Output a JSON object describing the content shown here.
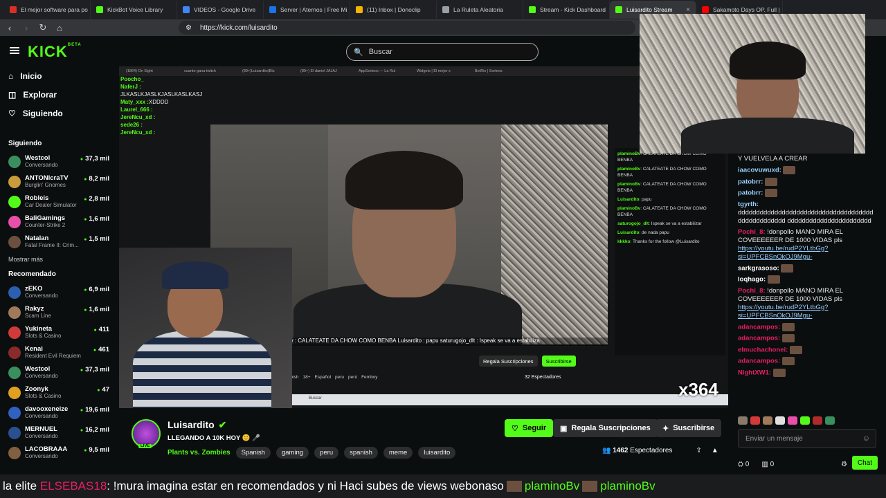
{
  "browser": {
    "tabs": [
      {
        "label": "El mejor software para po",
        "color": "#d93025"
      },
      {
        "label": "KickBot Voice Library",
        "color": "#53fc18"
      },
      {
        "label": "VIDEOS - Google Drive",
        "color": "#4285f4"
      },
      {
        "label": "Server | Aternos | Free Mi",
        "color": "#1a73e8"
      },
      {
        "label": "(11) Inbox | Donoclip",
        "color": "#f4b400"
      },
      {
        "label": "La Ruleta Aleatoria",
        "color": "#9aa0a6"
      },
      {
        "label": "Stream - Kick Dashboard",
        "color": "#53fc18"
      },
      {
        "label": "Luisardito Stream",
        "color": "#53fc18",
        "active": true
      },
      {
        "label": "Sakamoto Days OP. Full |",
        "color": "#ff0000"
      }
    ],
    "url": "https://kick.com/luisardito"
  },
  "kick": {
    "logo": "KICK",
    "logo_sup": "BETA",
    "search_placeholder": "Buscar"
  },
  "sidebar": {
    "nav": [
      {
        "label": "Inicio",
        "icon": "home-icon"
      },
      {
        "label": "Explorar",
        "icon": "compass-icon"
      },
      {
        "label": "Siguiendo",
        "icon": "heart-icon"
      }
    ],
    "following_title": "Siguiendo",
    "following": [
      {
        "name": "Westcol",
        "game": "Conversando",
        "viewers": "37,3 mil",
        "color": "#3a8f5e"
      },
      {
        "name": "ANTONIcraTV",
        "game": "Burglin' Gnomes",
        "viewers": "8,2 mil",
        "color": "#c99b3a"
      },
      {
        "name": "Robleis",
        "game": "Car Dealer Simulator",
        "viewers": "2,8 mil",
        "color": "#53fc18"
      },
      {
        "name": "BaliGamings",
        "game": "Counter-Strike 2",
        "viewers": "1,6 mil",
        "color": "#e94fa8"
      },
      {
        "name": "Natalan",
        "game": "Fatal Frame II: Crim...",
        "viewers": "1,5 mil",
        "color": "#6b5040"
      }
    ],
    "more_label": "Mostrar más",
    "recommended_title": "Recomendado",
    "recommended": [
      {
        "name": "zEKO",
        "game": "Conversando",
        "viewers": "6,9 mil",
        "color": "#2b5fb0"
      },
      {
        "name": "Rakyz",
        "game": "Scam Line",
        "viewers": "1,6 mil",
        "color": "#a07a5a"
      },
      {
        "name": "Yukineta",
        "game": "Slots & Casino",
        "viewers": "411",
        "color": "#d23a3a"
      },
      {
        "name": "Kenai",
        "game": "Resident Evil Requiem",
        "viewers": "461",
        "color": "#8a2a2a"
      },
      {
        "name": "Westcol",
        "game": "Conversando",
        "viewers": "37,3 mil",
        "color": "#3a8f5e"
      },
      {
        "name": "Zoonyk",
        "game": "Slots & Casino",
        "viewers": "47",
        "color": "#e0a020"
      },
      {
        "name": "davooxeneize",
        "game": "Conversando",
        "viewers": "19,6 mil",
        "color": "#3060c0"
      },
      {
        "name": "MERNUEL",
        "game": "Conversando",
        "viewers": "16,2 mil",
        "color": "#2a5090"
      },
      {
        "name": "LACOBRAAA",
        "game": "Conversando",
        "viewers": "9,5 mil",
        "color": "#806040"
      }
    ]
  },
  "stage": {
    "inner_tabs": [
      "(1864) On Sight",
      "cuanto gana twitch",
      "(89+)Luisardito(Blu",
      "(89+) El daniel JAJAJ",
      "AppSorteos — La Rul",
      "Widgets | El mejor s",
      "BotRix | Sorteos"
    ],
    "overlay_chat": [
      {
        "user": "Poocho_",
        "text": ""
      },
      {
        "user": "NaferJ :",
        "text": ""
      },
      {
        "user": "",
        "text": "JLKASLKJASLKJASLKASLKASJ"
      },
      {
        "user": "Maty_xxx :",
        "text": "XDDDD"
      },
      {
        "user": "Laurel_666 :",
        "text": ""
      },
      {
        "user": "JereNcu_xd :",
        "text": ""
      },
      {
        "user": "sede26 :",
        "text": ""
      },
      {
        "user": "JereNcu_xd :",
        "text": ""
      }
    ],
    "overlay_bar": "NBA  plaminoBv : CALATEATE DA CHOW COMO BENBA   Luisardito : papu   saturugojo_dlt : Ispeak se va a estabiliza",
    "inner_chat": [
      {
        "user": "plaminoBv",
        "text": "CALATEATE DA CHOW COMO BENBA"
      },
      {
        "user": "plaminoBv",
        "text": "CALATEATE DA CHOW COMO BENBA"
      },
      {
        "user": "plaminoBv",
        "text": "CALATEATE DA CHOW COMO BENBA"
      },
      {
        "user": "Luisardito",
        "text": "papu"
      },
      {
        "user": "plaminoBv",
        "text": "CALATEATE DA CHOW COMO BENBA"
      },
      {
        "user": "saturogojo_dlt",
        "text": "Ispeak se va a estabilizar"
      },
      {
        "user": "Luisardito",
        "text": "de nada papu"
      },
      {
        "user": "kkkko",
        "text": "Thanks for the follow @Luisardito"
      }
    ],
    "inner_buttons": {
      "gift": "Regala Suscripciones",
      "sub": "Suscribirse"
    },
    "inner_viewers": "32 Espectadores",
    "inner_tags": [
      "Spanish",
      "18+",
      "Español",
      "peru",
      "perú",
      "Femboy"
    ],
    "inner_search": "Buscar",
    "watermark": "x364"
  },
  "chat": {
    "messages": [
      {
        "user": "",
        "color": "#fff",
        "text": "Y VUELVELA A CREAR"
      },
      {
        "user": "iaacovuwuxd:",
        "color": "#9ad0ff",
        "text": ""
      },
      {
        "user": "patobrr:",
        "color": "#9ad0ff",
        "text": ""
      },
      {
        "user": "patobrr:",
        "color": "#9ad0ff",
        "text": ""
      },
      {
        "user": "tgyrth:",
        "color": "#9ad0ff",
        "text": "dddddddddddddddddddddddddddddddddddddddddddddddddd ddddddddddddddddddddddd"
      },
      {
        "user": "Pochi_8:",
        "color": "#e91e63",
        "text": "!donpollo MANO MIRA EL COVEEEEEER DE 1000 VIDAS pls",
        "link": "https://youtu.be/rudP2YLtbGg?si=UPFCBSnOkOJ9Mgu-"
      },
      {
        "user": "sarkgrasoso:",
        "color": "#ffffff",
        "text": ""
      },
      {
        "user": "loqhago:",
        "color": "#ffffff",
        "text": ""
      },
      {
        "user": "Pochi_8:",
        "color": "#e91e63",
        "text": "!donpollo MANO MIRA EL COVEEEEEER DE 1000 VIDAS pls",
        "link": "https://youtu.be/rudP2YLtbGg?si=UPFCBSnOkOJ9Mgu-"
      },
      {
        "user": "adancampos:",
        "color": "#e91e63",
        "text": ""
      },
      {
        "user": "adancampos:",
        "color": "#e91e63",
        "text": ""
      },
      {
        "user": "elmuchachonei:",
        "color": "#e91e63",
        "text": ""
      },
      {
        "user": "adancampos:",
        "color": "#e91e63",
        "text": ""
      },
      {
        "user": "NightXW1:",
        "color": "#e91e63",
        "text": ""
      }
    ],
    "input_placeholder": "Enviar un mensaje",
    "points": "0",
    "gifts": "0",
    "send_label": "Chat"
  },
  "channel": {
    "name": "Luisardito",
    "live_badge": "LIVE",
    "title": "LLEGANDO A 10K HOY 😊 🎤",
    "category": "Plants vs. Zombies",
    "tags": [
      "Spanish",
      "gaming",
      "peru",
      "spanish",
      "meme",
      "luisardito"
    ],
    "follow_label": "Seguir",
    "gift_label": "Regala Suscripciones",
    "sub_label": "Suscribirse",
    "viewers_count": "1462",
    "viewers_label": "Espectadores"
  },
  "ticker": {
    "text1": "la elite",
    "user1": "ELSEBAS18",
    "text2": ": !mura imagina estar en recomendados y ni Haci subes de views webonaso",
    "user2": "plaminoBv",
    "user3": "plaminoBv"
  }
}
